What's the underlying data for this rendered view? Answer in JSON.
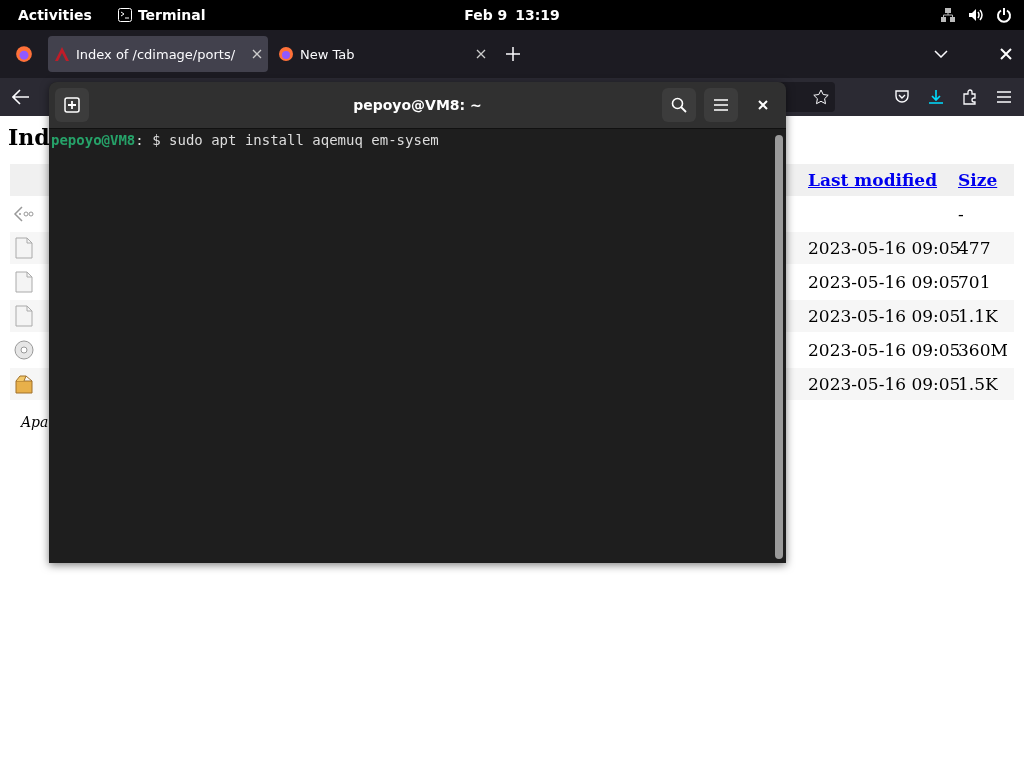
{
  "top_bar": {
    "activities": "Activities",
    "app": "Terminal",
    "date": "Feb 9",
    "time": "13:19"
  },
  "browser": {
    "tabs": [
      {
        "title": "Index of /cdimage/ports/",
        "selected": true
      },
      {
        "title": "New Tab",
        "selected": false
      }
    ],
    "page": {
      "heading": "Ind",
      "columns": [
        "Last modified",
        "Size"
      ],
      "rows": [
        {
          "kind": "back",
          "size": "-"
        },
        {
          "kind": "text",
          "modified": "2023-05-16 09:05",
          "size": "477"
        },
        {
          "kind": "text",
          "modified": "2023-05-16 09:05",
          "size": "701"
        },
        {
          "kind": "text",
          "modified": "2023-05-16 09:05",
          "size": "1.1K"
        },
        {
          "kind": "disc",
          "modified": "2023-05-16 09:05",
          "size": "360M"
        },
        {
          "kind": "package",
          "modified": "2023-05-16 09:05",
          "size": "1.5K"
        }
      ],
      "footer": "Apa"
    }
  },
  "terminal": {
    "title": "pepoyo@VM8: ~",
    "prompt_user": "pepoyo@VM8",
    "prompt_sep": ":",
    "command": "$ sudo apt install aqemuq em-sysem"
  }
}
